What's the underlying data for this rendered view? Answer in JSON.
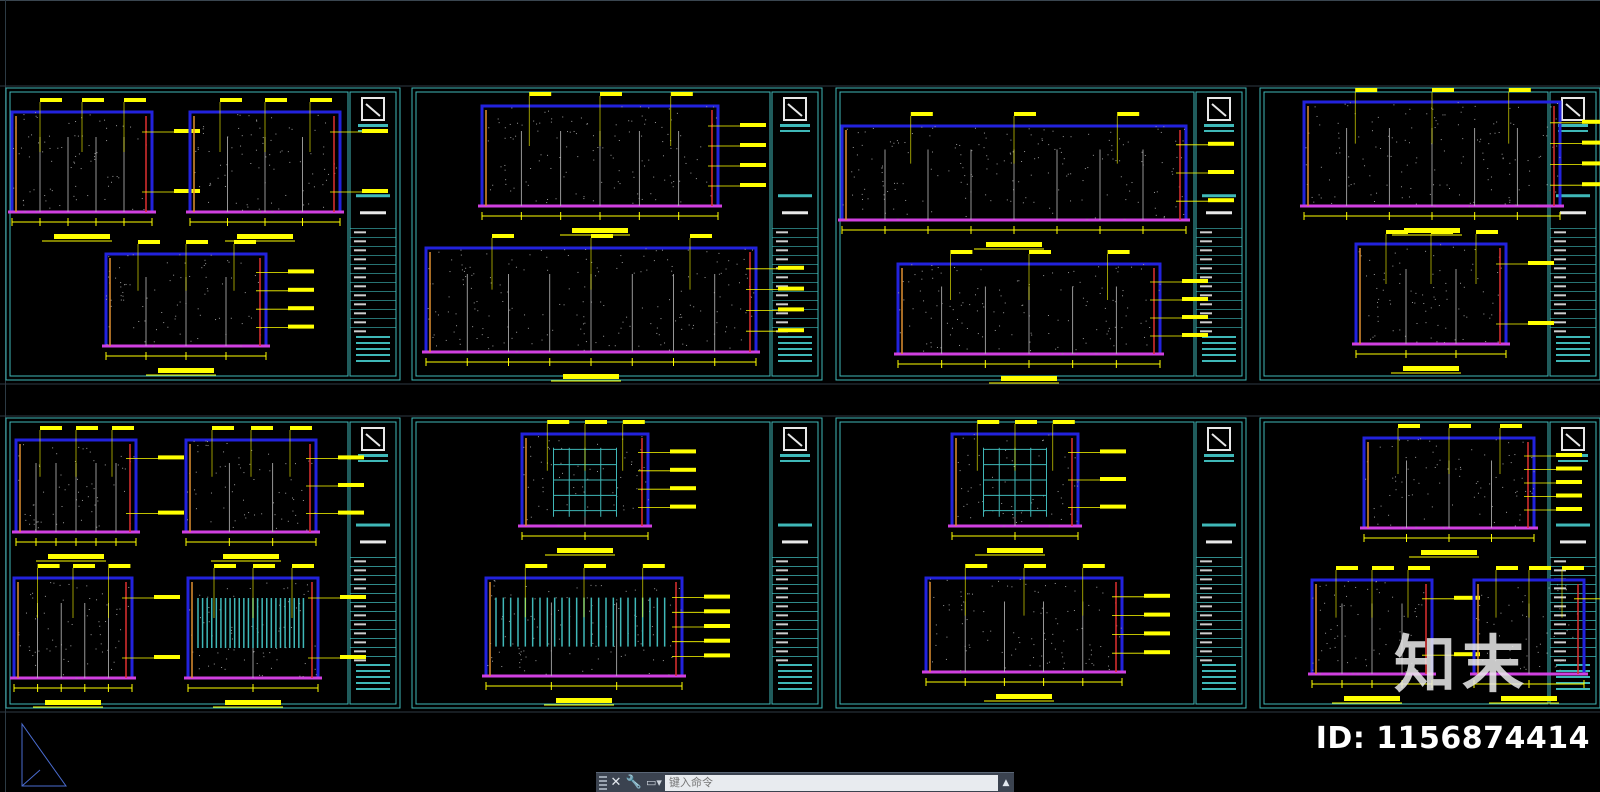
{
  "watermark": {
    "brand": "知末",
    "id_label": "ID: 1156874414"
  },
  "command_line": {
    "close_icon": "close-icon",
    "settings_icon": "wrench-icon",
    "prompt_icon": "command-prompt-icon",
    "placeholder": "键入命令",
    "expand_icon": "chevron-up-icon"
  },
  "colors": {
    "background": "#000000",
    "frame": "#3fb8b8",
    "wall": "#2222dd",
    "floor": "#d040e0",
    "dimension": "#ffff00",
    "detail_red": "#e03030",
    "detail_green": "#30c060",
    "detail_orange": "#e09030"
  },
  "ucs_icon": "ucs-icon"
}
